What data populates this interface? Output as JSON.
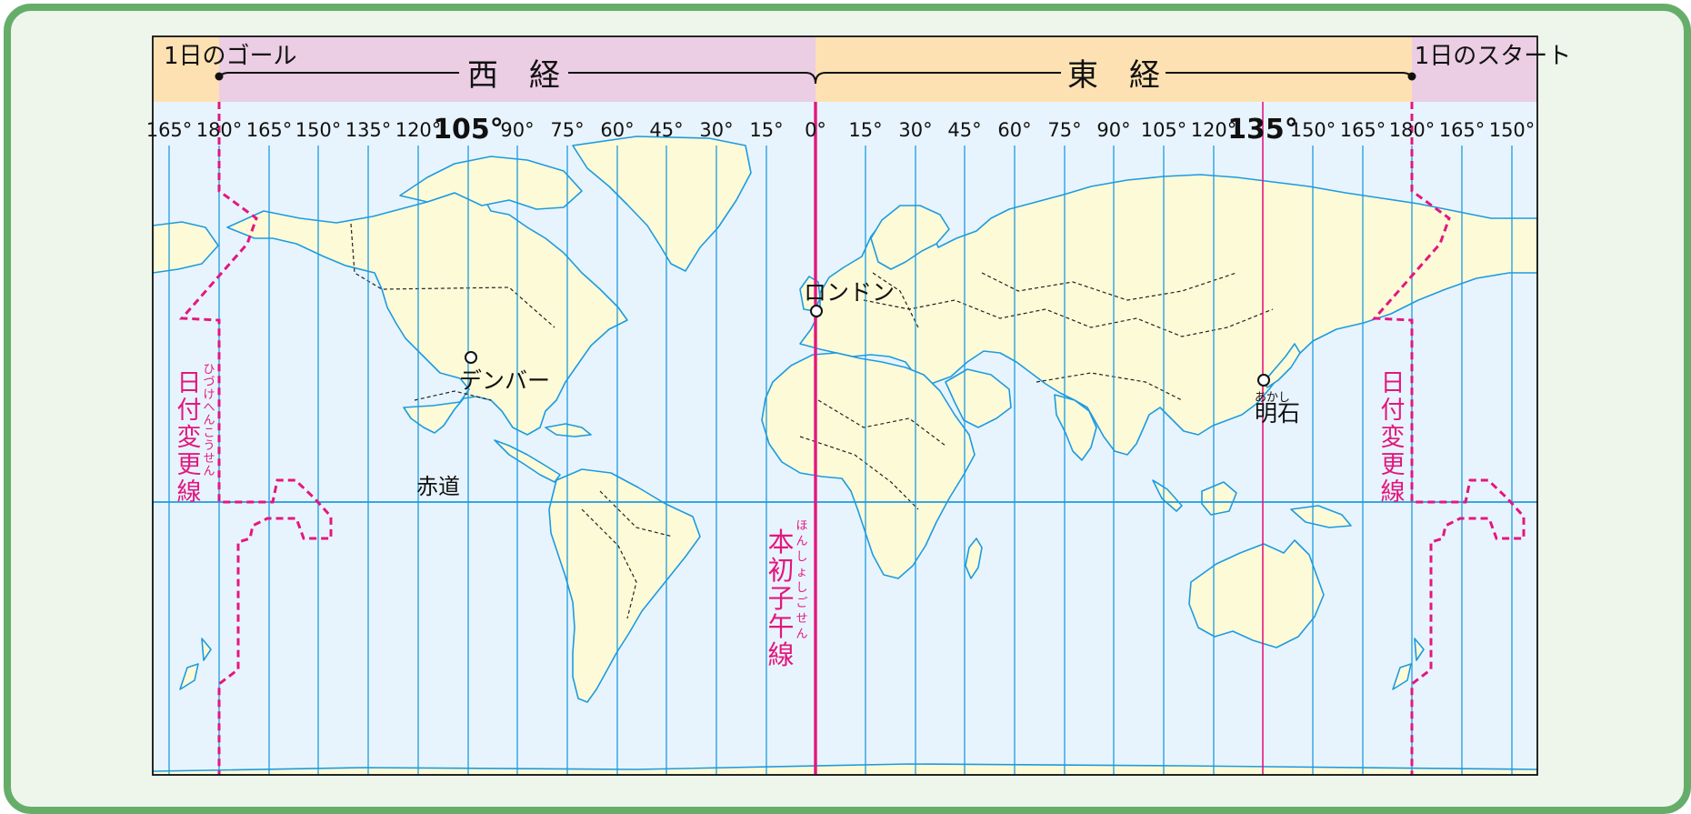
{
  "colors": {
    "frame_border": "#66ad6a",
    "frame_fill": "#eef6ec",
    "ocean": "#e8f4fd",
    "land": "#fdfad7",
    "meridian": "#1d9be0",
    "coast": "#1d9be0",
    "prime_meridian": "#e3177e",
    "date_line": "#e3177e",
    "west_band": "#ebcde4",
    "east_band": "#fde1b2",
    "text": "#111111",
    "magenta_text": "#e3177e"
  },
  "banner": {
    "west": "西　経",
    "east": "東　経",
    "day_goal": "1日のゴール",
    "day_start": "1日のスタート"
  },
  "degree_labels": [
    "165°",
    "180°",
    "165°",
    "150°",
    "135°",
    "120°",
    "105°",
    "90°",
    "75°",
    "60°",
    "45°",
    "30°",
    "15°",
    "0°",
    "15°",
    "30°",
    "45°",
    "60°",
    "75°",
    "90°",
    "105°",
    "120°",
    "135°",
    "150°",
    "165°",
    "180°",
    "165°",
    "150°"
  ],
  "places": {
    "london": "ロンドン",
    "denver": "デンバー",
    "akashi": "明石",
    "akashi_ruby": "あかし",
    "equator": "赤道"
  },
  "lines": {
    "date_line": "日付変更線",
    "date_line_ruby": "ひづけへんこうせん",
    "prime_meridian": "本初子午線",
    "prime_meridian_ruby": "ほんしょしごせん"
  }
}
